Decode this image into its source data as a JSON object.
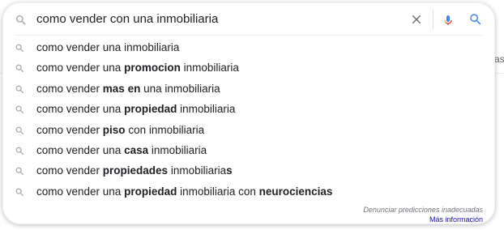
{
  "search": {
    "query": "como vender con una inmobiliaria"
  },
  "background": {
    "partial_text": "as"
  },
  "suggestions": [
    {
      "segments": [
        {
          "t": "como vender una inmobiliaria",
          "b": false
        }
      ]
    },
    {
      "segments": [
        {
          "t": "como vender una ",
          "b": false
        },
        {
          "t": "promocion",
          "b": true
        },
        {
          "t": " inmobiliaria",
          "b": false
        }
      ]
    },
    {
      "segments": [
        {
          "t": "como vender ",
          "b": false
        },
        {
          "t": "mas en",
          "b": true
        },
        {
          "t": " una inmobiliaria",
          "b": false
        }
      ]
    },
    {
      "segments": [
        {
          "t": "como vender una ",
          "b": false
        },
        {
          "t": "propiedad",
          "b": true
        },
        {
          "t": " inmobiliaria",
          "b": false
        }
      ]
    },
    {
      "segments": [
        {
          "t": "como vender ",
          "b": false
        },
        {
          "t": "piso",
          "b": true
        },
        {
          "t": " con inmobiliaria",
          "b": false
        }
      ]
    },
    {
      "segments": [
        {
          "t": "como vender una ",
          "b": false
        },
        {
          "t": "casa",
          "b": true
        },
        {
          "t": " inmobiliaria",
          "b": false
        }
      ]
    },
    {
      "segments": [
        {
          "t": "como vender ",
          "b": false
        },
        {
          "t": "propiedades",
          "b": true
        },
        {
          "t": " inmobiliaria",
          "b": false
        },
        {
          "t": "s",
          "b": true
        }
      ]
    },
    {
      "segments": [
        {
          "t": "como vender una ",
          "b": false
        },
        {
          "t": "propiedad",
          "b": true
        },
        {
          "t": " inmobiliaria con ",
          "b": false
        },
        {
          "t": "neurociencias",
          "b": true
        }
      ]
    }
  ],
  "footer": {
    "report_label": "Denunciar predicciones inadecuadas",
    "more_label": "Más información"
  },
  "icons": {
    "leading": "search-icon",
    "clear": "close-icon",
    "voice": "microphone-icon",
    "submit": "search-icon",
    "suggestion": "search-icon"
  },
  "colors": {
    "google_blue": "#4285f4",
    "google_red": "#ea4335",
    "google_yellow": "#fbbc05",
    "google_green": "#34a853",
    "link": "#1a0dab"
  }
}
